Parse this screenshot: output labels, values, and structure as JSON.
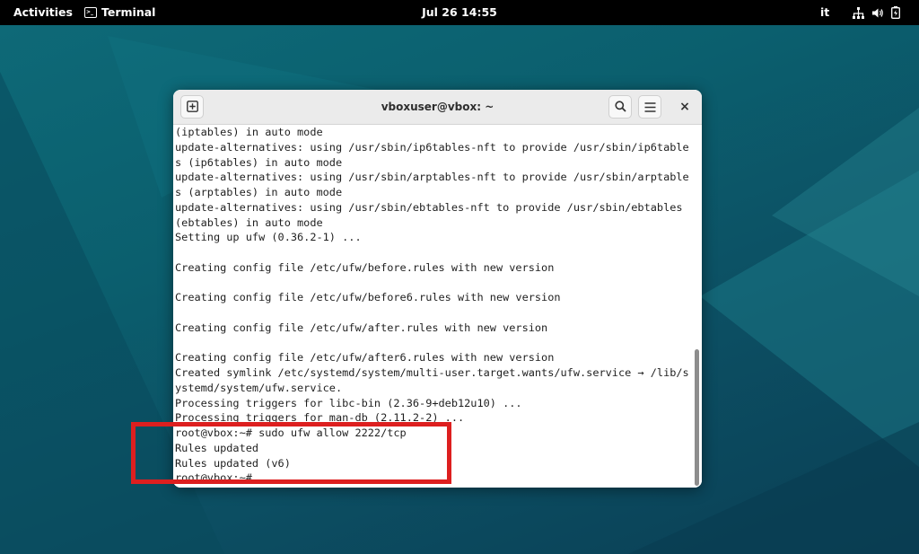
{
  "topbar": {
    "activities": "Activities",
    "app_name": "Terminal",
    "clock": "Jul 26  14:55",
    "language": "it",
    "icons": [
      "network-icon",
      "volume-icon",
      "battery-icon"
    ]
  },
  "window": {
    "title": "vboxuser@vbox: ~",
    "buttons": [
      "new-tab-icon",
      "search-icon",
      "hamburger-menu-icon",
      "close-icon"
    ],
    "close_glyph": "×"
  },
  "terminal": {
    "lines": [
      "(iptables) in auto mode",
      "update-alternatives: using /usr/sbin/ip6tables-nft to provide /usr/sbin/ip6table",
      "s (ip6tables) in auto mode",
      "update-alternatives: using /usr/sbin/arptables-nft to provide /usr/sbin/arptable",
      "s (arptables) in auto mode",
      "update-alternatives: using /usr/sbin/ebtables-nft to provide /usr/sbin/ebtables",
      "(ebtables) in auto mode",
      "Setting up ufw (0.36.2-1) ...",
      "",
      "Creating config file /etc/ufw/before.rules with new version",
      "",
      "Creating config file /etc/ufw/before6.rules with new version",
      "",
      "Creating config file /etc/ufw/after.rules with new version",
      "",
      "Creating config file /etc/ufw/after6.rules with new version",
      "Created symlink /etc/systemd/system/multi-user.target.wants/ufw.service → /lib/s",
      "ystemd/system/ufw.service.",
      "Processing triggers for libc-bin (2.36-9+deb12u10) ...",
      "Processing triggers for man-db (2.11.2-2) ...",
      "root@vbox:~# sudo ufw allow 2222/tcp",
      "Rules updated",
      "Rules updated (v6)",
      "root@vbox:~#"
    ]
  },
  "colors": {
    "annotation_box": "#dd1f1f",
    "desktop": "#0b5f6e"
  }
}
